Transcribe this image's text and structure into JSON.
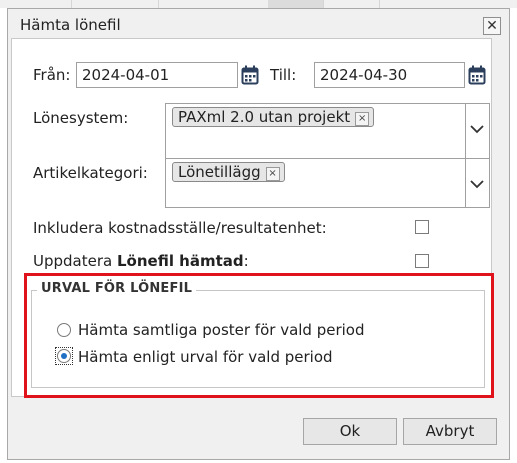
{
  "dialog": {
    "title": "Hämta lönefil",
    "close_symbol": "✕"
  },
  "fields": {
    "from_label": "Från:",
    "from_value": "2024-04-01",
    "to_label": "Till:",
    "to_value": "2024-04-30",
    "lonesystem_label": "Lönesystem:",
    "lonesystem_chip": "PAXml 2.0 utan projekt",
    "artikel_label": "Artikelkategori:",
    "artikel_chip": "Lönetillägg",
    "chip_remove_symbol": "×",
    "include_label": "Inkludera kostnadsställe/resultatenhet:",
    "update_label_prefix": "Uppdatera ",
    "update_label_bold": "Lönefil hämtad",
    "update_label_suffix": ":"
  },
  "selection": {
    "legend": "URVAL FÖR LÖNEFIL",
    "option_all": "Hämta samtliga poster för vald period",
    "option_selection": "Hämta enligt urval för vald period",
    "selected_option": "option_selection"
  },
  "buttons": {
    "ok": "Ok",
    "cancel": "Avbryt"
  },
  "colors": {
    "highlight_frame": "#e0121c",
    "radio_selected": "#1f6fc5"
  },
  "icons": {
    "calendar": "calendar-icon",
    "dropdown": "chevron-down-icon",
    "close": "close-icon"
  }
}
